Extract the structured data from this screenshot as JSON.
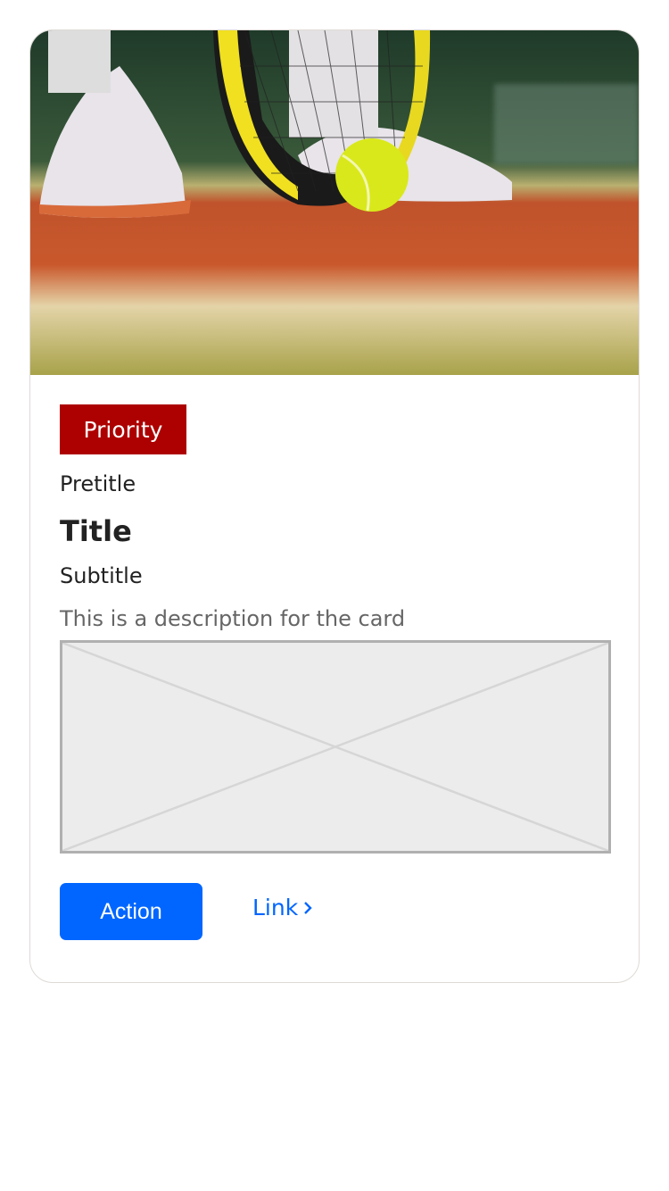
{
  "card": {
    "image_alt": "tennis player shoes with racket and ball on clay court",
    "badge": "Priority",
    "pretitle": "Pretitle",
    "title": "Title",
    "subtitle": "Subtitle",
    "description": "This is a description for the card",
    "action_label": "Action",
    "link_label": "Link",
    "link_icon": "chevron-right-icon"
  },
  "colors": {
    "badge": "#ad0000",
    "accent": "#0066ff"
  }
}
